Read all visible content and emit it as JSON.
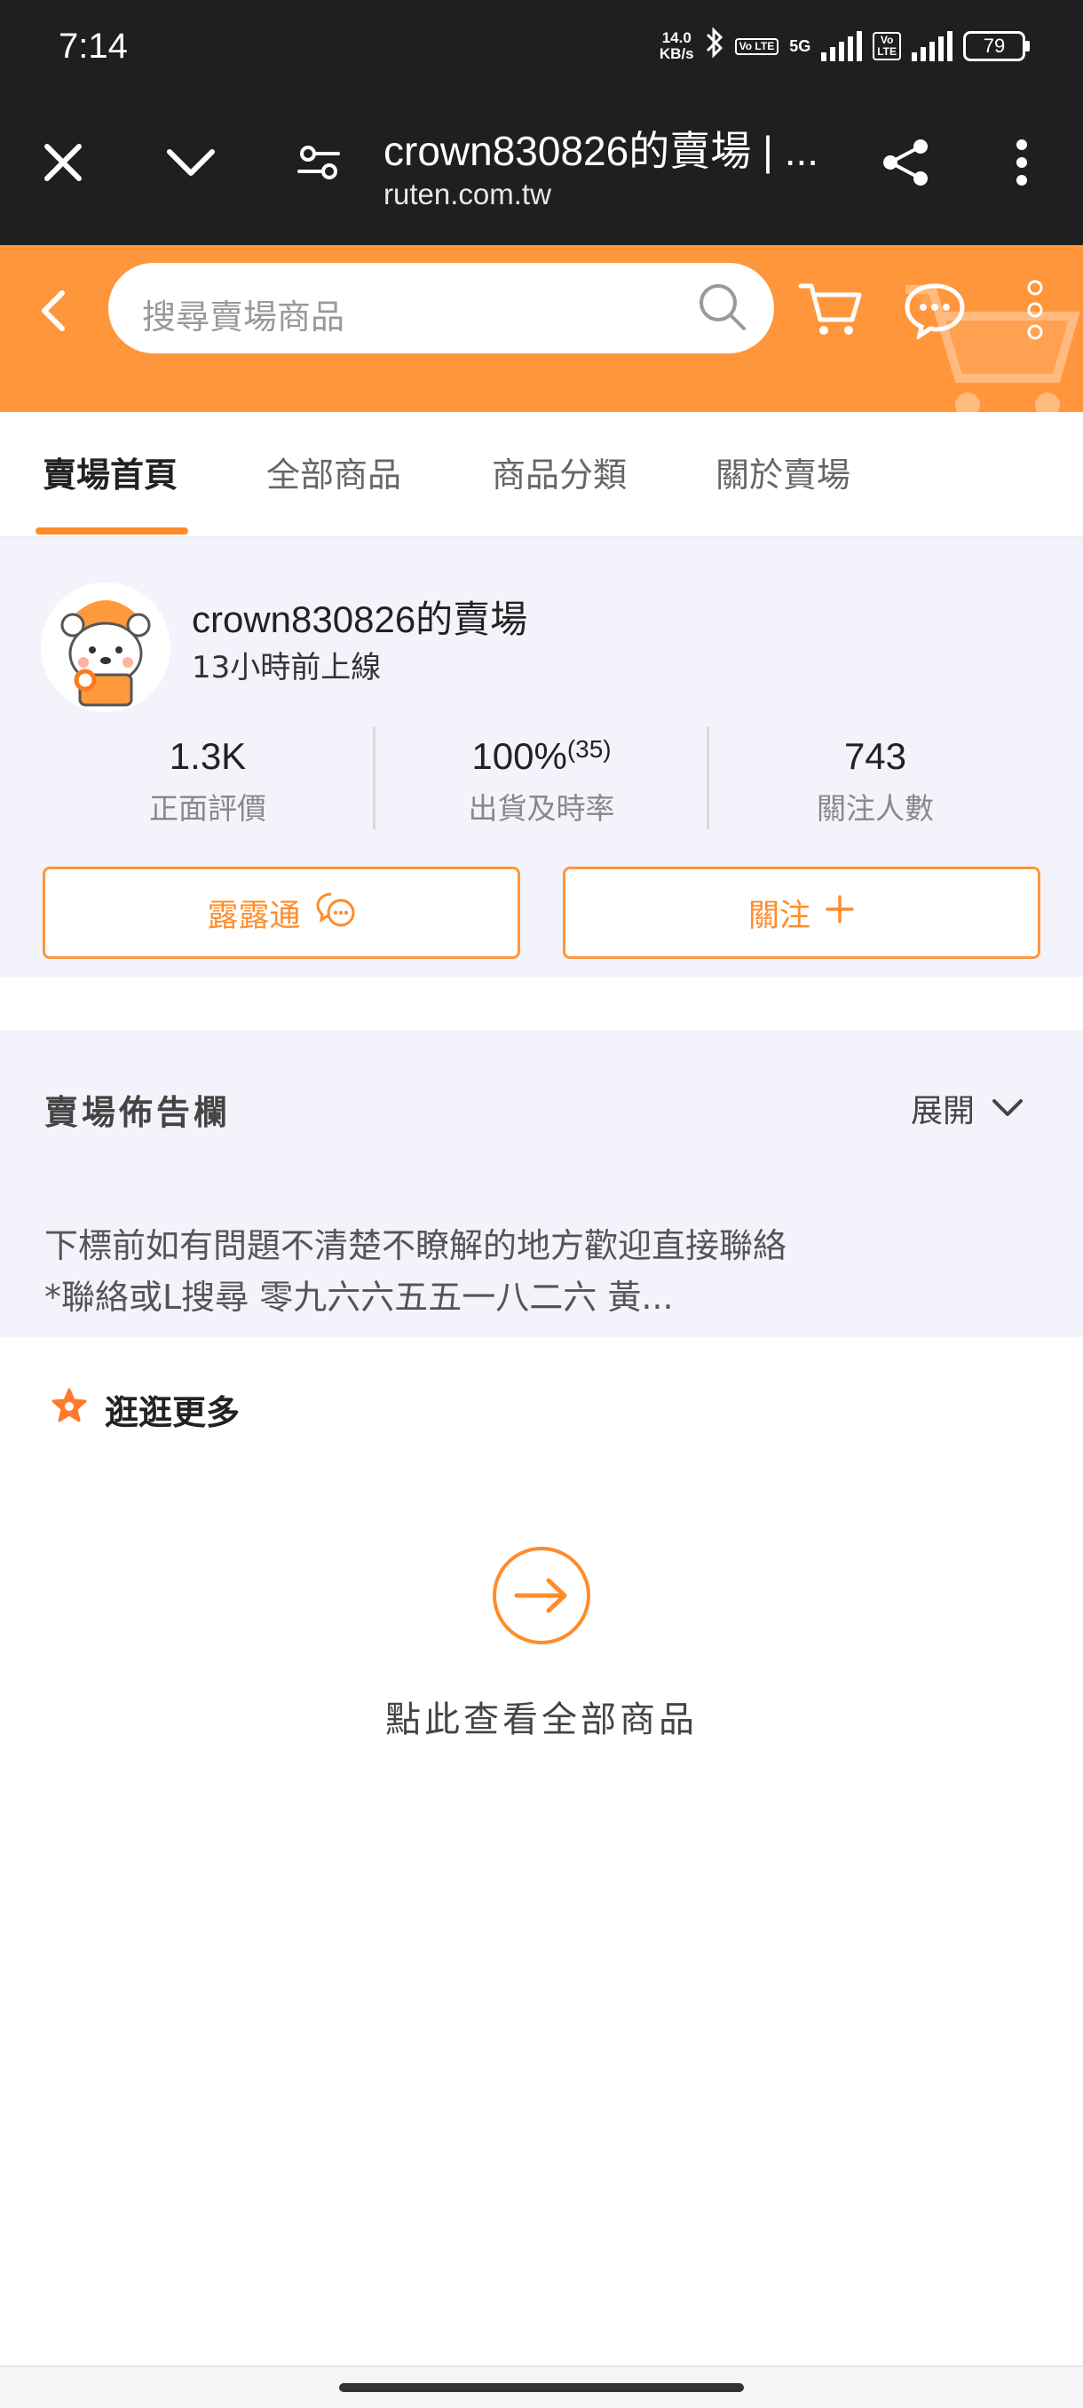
{
  "status_bar": {
    "time": "7:14",
    "speed_value": "14.0",
    "speed_unit": "KB/s",
    "network": "5G",
    "volte": "Vo LTE",
    "battery": "79"
  },
  "browser": {
    "title": "crown830826的賣場 | ...",
    "url": "ruten.com.tw",
    "icons": [
      "close-icon",
      "chevron-down-icon",
      "page-settings-icon",
      "share-icon",
      "more-vert-icon"
    ]
  },
  "header": {
    "search_placeholder": "搜尋賣場商品",
    "icons": [
      "back-icon",
      "search-icon",
      "cart-icon",
      "chat-icon",
      "more-vert-icon"
    ],
    "accent": "#ff963c"
  },
  "tabs": [
    {
      "label": "賣場首頁",
      "active": true
    },
    {
      "label": "全部商品",
      "active": false
    },
    {
      "label": "商品分類",
      "active": false
    },
    {
      "label": "關於賣場",
      "active": false
    }
  ],
  "store": {
    "name": "crown830826的賣場",
    "last_online": "13小時前上線",
    "stats": [
      {
        "value": "1.3K",
        "suffix": "",
        "label": "正面評價"
      },
      {
        "value": "100%",
        "suffix": "(35)",
        "label": "出貨及時率"
      },
      {
        "value": "743",
        "suffix": "",
        "label": "關注人數"
      }
    ],
    "chat_button": "露露通",
    "follow_button": "關注"
  },
  "notice": {
    "title": "賣場佈告欄",
    "expand": "展開",
    "lines": [
      "下標前如有問題不清楚不瞭解的地方歡迎直接聯絡",
      "*聯絡或L搜尋  零九六六五五一八二六  黃..."
    ]
  },
  "browse_more": {
    "title": "逛逛更多",
    "view_all": "點此查看全部商品"
  }
}
